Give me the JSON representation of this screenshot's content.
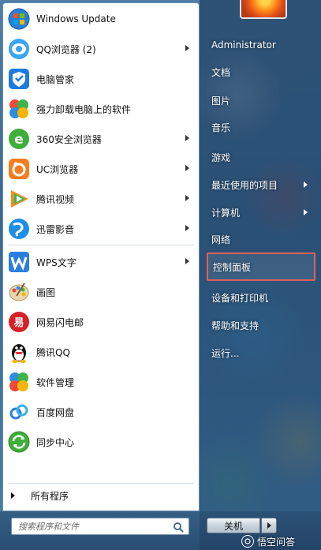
{
  "left_menu": {
    "items": [
      {
        "label": "Windows Update",
        "icon": "windows-update-icon",
        "has_arrow": false
      },
      {
        "label": "QQ浏览器 (2)",
        "icon": "qq-browser-icon",
        "has_arrow": true
      },
      {
        "label": "电脑管家",
        "icon": "pc-manager-shield-icon",
        "has_arrow": false
      },
      {
        "label": "强力卸载电脑上的软件",
        "icon": "uninstaller-icon",
        "has_arrow": false
      },
      {
        "label": "360安全浏览器",
        "icon": "360-browser-icon",
        "has_arrow": true
      },
      {
        "label": "UC浏览器",
        "icon": "uc-browser-icon",
        "has_arrow": true
      },
      {
        "label": "腾讯视频",
        "icon": "tencent-video-icon",
        "has_arrow": true
      },
      {
        "label": "迅雷影音",
        "icon": "xunlei-player-icon",
        "has_arrow": true
      },
      {
        "label": "WPS文字",
        "icon": "wps-writer-icon",
        "has_arrow": true
      },
      {
        "label": "画图",
        "icon": "paint-palette-icon",
        "has_arrow": false
      },
      {
        "label": "网易闪电邮",
        "icon": "netease-mail-icon",
        "has_arrow": false
      },
      {
        "label": "腾讯QQ",
        "icon": "qq-penguin-icon",
        "has_arrow": false
      },
      {
        "label": "软件管理",
        "icon": "software-manager-icon",
        "has_arrow": false
      },
      {
        "label": "百度网盘",
        "icon": "baidu-netdisk-icon",
        "has_arrow": false
      },
      {
        "label": "同步中心",
        "icon": "sync-center-icon",
        "has_arrow": false
      }
    ],
    "all_programs": "所有程序"
  },
  "search": {
    "placeholder": "搜索程序和文件"
  },
  "right_menu": {
    "items": [
      {
        "label": "Administrator",
        "has_arrow": false,
        "highlighted": false
      },
      {
        "label": "文档",
        "has_arrow": false,
        "highlighted": false
      },
      {
        "label": "图片",
        "has_arrow": false,
        "highlighted": false
      },
      {
        "label": "音乐",
        "has_arrow": false,
        "highlighted": false
      },
      {
        "label": "游戏",
        "has_arrow": false,
        "highlighted": false
      },
      {
        "label": "最近使用的项目",
        "has_arrow": true,
        "highlighted": false
      },
      {
        "label": "计算机",
        "has_arrow": true,
        "highlighted": false
      },
      {
        "label": "网络",
        "has_arrow": false,
        "highlighted": false
      },
      {
        "label": "控制面板",
        "has_arrow": false,
        "highlighted": true
      },
      {
        "label": "设备和打印机",
        "has_arrow": false,
        "highlighted": false
      },
      {
        "label": "帮助和支持",
        "has_arrow": false,
        "highlighted": false
      },
      {
        "label": "运行...",
        "has_arrow": false,
        "highlighted": false
      }
    ]
  },
  "shutdown": {
    "label": "关机"
  },
  "watermark": {
    "text": "悟空问答"
  },
  "colors": {
    "highlight_border": "#e0605a",
    "menu_bg": "#ffffff"
  }
}
